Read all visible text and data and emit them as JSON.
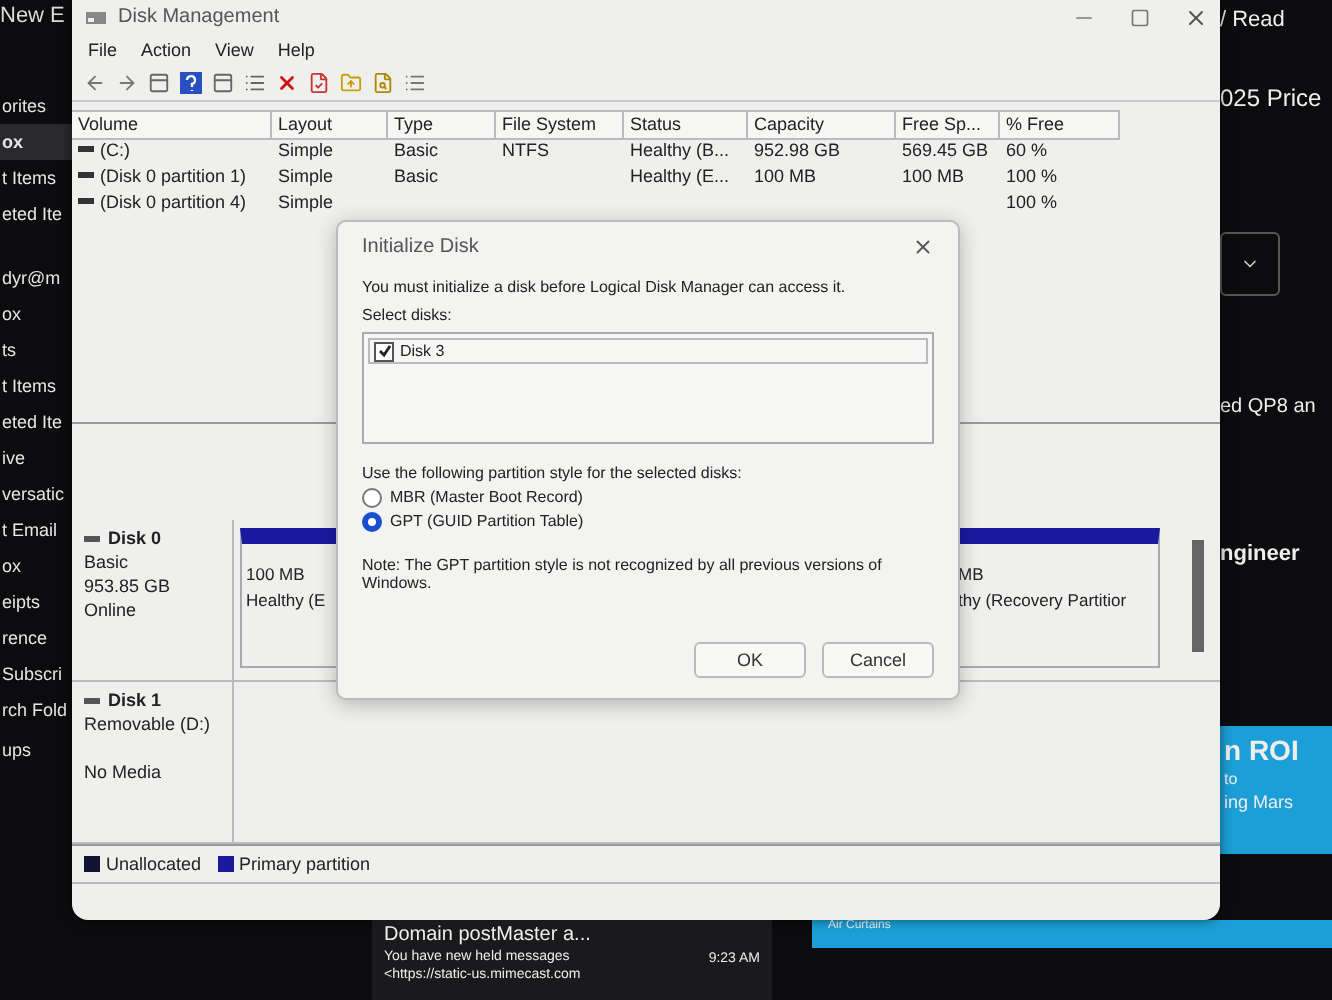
{
  "background": {
    "top_left": "New E",
    "sidebar": [
      {
        "label": "orites",
        "selected": false
      },
      {
        "label": "ox",
        "selected": true
      },
      {
        "label": "t Items",
        "selected": false
      },
      {
        "label": "eted Ite",
        "selected": false
      },
      {
        "label": "dyr@m",
        "selected": false
      },
      {
        "label": "ox",
        "selected": false
      },
      {
        "label": "ts",
        "selected": false
      },
      {
        "label": "t Items",
        "selected": false
      },
      {
        "label": "eted Ite",
        "selected": false
      },
      {
        "label": "ive",
        "selected": false
      },
      {
        "label": "versatic",
        "selected": false
      },
      {
        "label": "t Email",
        "selected": false
      },
      {
        "label": "ox",
        "selected": false
      },
      {
        "label": "eipts",
        "selected": false
      },
      {
        "label": "rence",
        "selected": false
      },
      {
        "label": "Subscri",
        "selected": false
      },
      {
        "label": "rch Fold",
        "selected": false
      },
      {
        "label": "ups",
        "selected": false
      }
    ],
    "right": {
      "read": "/ Read",
      "headline": "025 Price",
      "snippet_1": "ed QP8 an",
      "snippet_2": "ngineer",
      "ad_title": "n ROI",
      "ad_line_1": "to",
      "ad_line_2": "ing Mars"
    },
    "email": {
      "sender": "Domain postMaster a...",
      "subject": "You have new held messages",
      "time": "9:23 AM",
      "preview": "<https://static-us.mimecast.com"
    },
    "ad_caption": "Air Curtains"
  },
  "window": {
    "title": "Disk Management",
    "menu": [
      "File",
      "Action",
      "View",
      "Help"
    ],
    "table": {
      "columns": [
        "Volume",
        "Layout",
        "Type",
        "File System",
        "Status",
        "Capacity",
        "Free Sp...",
        "% Free"
      ],
      "rows": [
        [
          "(C:)",
          "Simple",
          "Basic",
          "NTFS",
          "Healthy (B...",
          "952.98 GB",
          "569.45 GB",
          "60 %"
        ],
        [
          "(Disk 0 partition 1)",
          "Simple",
          "Basic",
          null,
          "Healthy (E...",
          "100 MB",
          "100 MB",
          "100 %"
        ],
        [
          "(Disk 0 partition 4)",
          "Simple",
          null,
          null,
          null,
          null,
          null,
          "100 %"
        ]
      ]
    },
    "disks": [
      {
        "name": "Disk 0",
        "kind": "basic",
        "lines": [
          "Basic",
          "953.85 GB",
          "Online"
        ],
        "partitions": [
          {
            "size": "100 MB",
            "status": "Healthy (E"
          },
          {
            "size": "MB",
            "status": "thy (Recovery Partitior"
          }
        ]
      },
      {
        "name": "Disk 1",
        "kind": "removable",
        "lines": [
          "Removable (D:)",
          "No Media"
        ]
      }
    ],
    "legend": [
      {
        "label": "Unallocated",
        "color": "#141432"
      },
      {
        "label": "Primary partition",
        "color": "#1a1a9c"
      }
    ]
  },
  "dialog": {
    "title": "Initialize Disk",
    "intro": "You must initialize a disk before Logical Disk Manager can access it.",
    "select_label": "Select disks:",
    "disks": [
      {
        "label": "Disk 3",
        "checked": true
      }
    ],
    "style_label": "Use the following partition style for the selected disks:",
    "options": [
      {
        "label": "MBR (Master Boot Record)",
        "selected": false
      },
      {
        "label": "GPT (GUID Partition Table)",
        "selected": true
      }
    ],
    "note": "Note: The GPT partition style is not recognized by all previous versions of Windows.",
    "buttons": [
      "OK",
      "Cancel"
    ]
  }
}
